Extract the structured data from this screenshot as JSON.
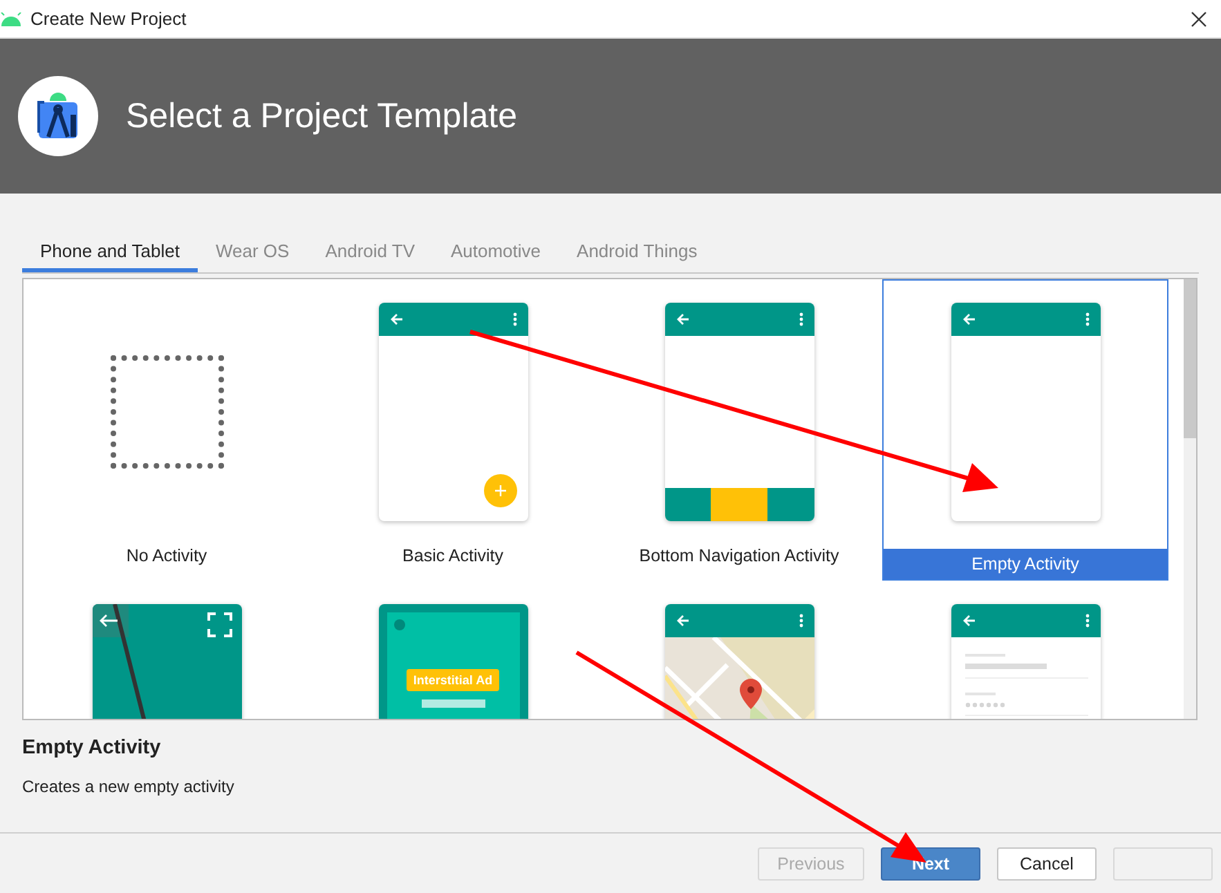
{
  "window": {
    "title": "Create New Project"
  },
  "header": {
    "title": "Select a Project Template"
  },
  "tabs": [
    {
      "label": "Phone and Tablet",
      "selected": true
    },
    {
      "label": "Wear OS",
      "selected": false
    },
    {
      "label": "Android TV",
      "selected": false
    },
    {
      "label": "Automotive",
      "selected": false
    },
    {
      "label": "Android Things",
      "selected": false
    }
  ],
  "templates": [
    {
      "kind": "none",
      "label": "No Activity",
      "selected": false
    },
    {
      "kind": "basic",
      "label": "Basic Activity",
      "selected": false
    },
    {
      "kind": "bottom_nav",
      "label": "Bottom Navigation Activity",
      "selected": false
    },
    {
      "kind": "empty",
      "label": "Empty Activity",
      "selected": true
    },
    {
      "kind": "fullscreen",
      "selected": false
    },
    {
      "kind": "ad",
      "ad_label": "Interstitial Ad",
      "selected": false
    },
    {
      "kind": "maps",
      "selected": false
    },
    {
      "kind": "login",
      "selected": false
    }
  ],
  "details": {
    "title": "Empty Activity",
    "description": "Creates a new empty activity"
  },
  "buttons": [
    {
      "kind": "default",
      "label": "Previous",
      "disabled": true
    },
    {
      "kind": "primary",
      "label": "Next",
      "disabled": false
    },
    {
      "kind": "default",
      "label": "Cancel",
      "disabled": false
    },
    {
      "kind": "default",
      "disabled": true
    }
  ]
}
